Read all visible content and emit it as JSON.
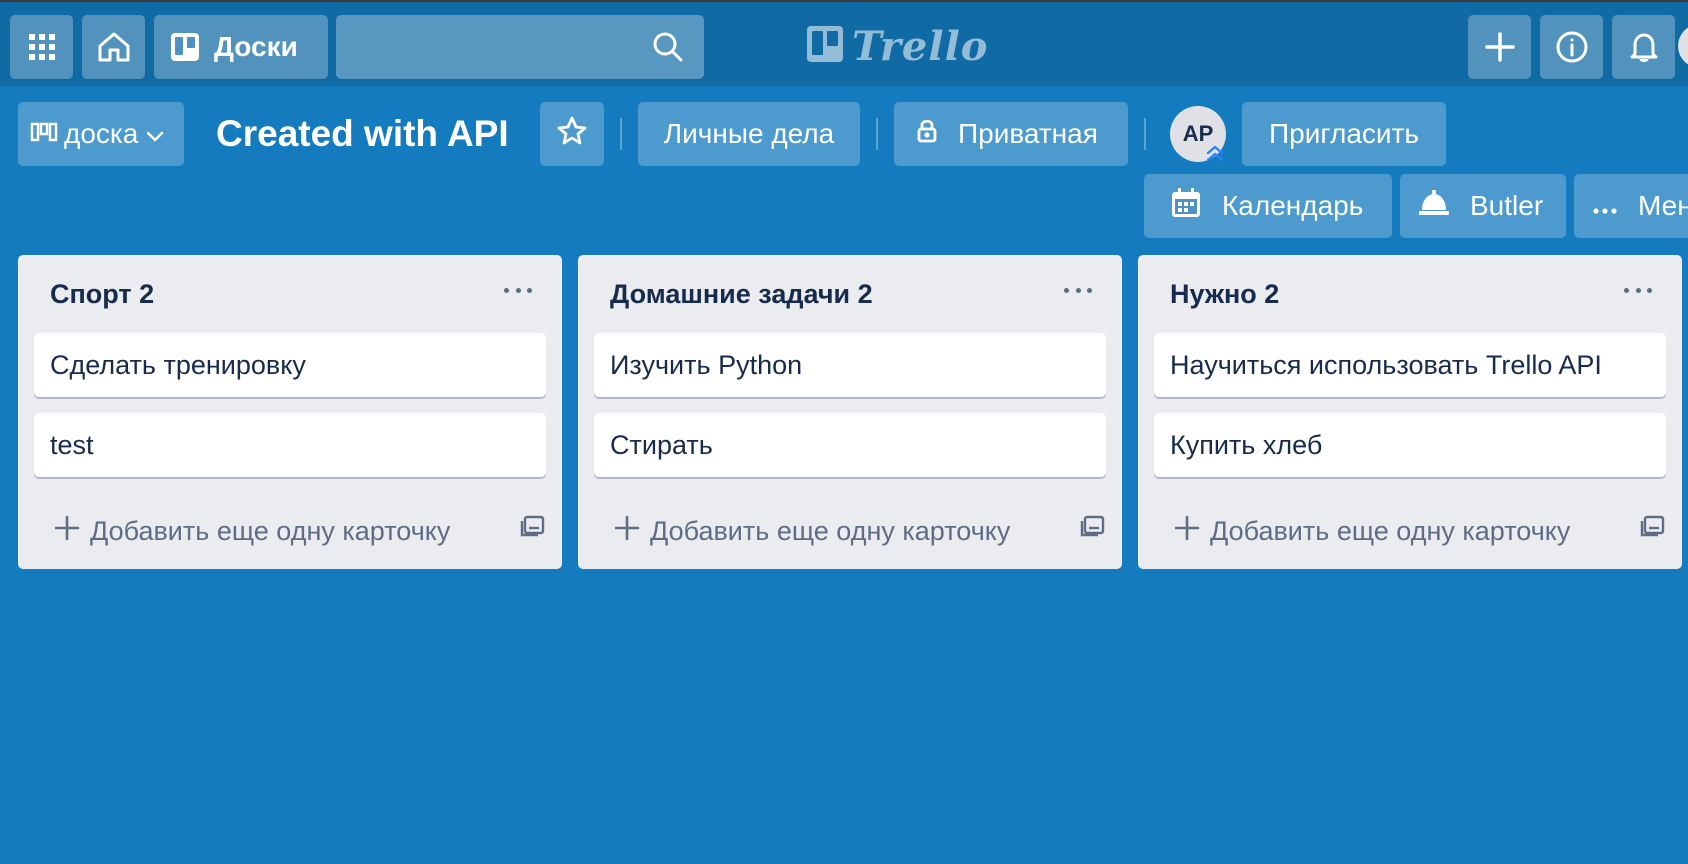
{
  "topbar": {
    "boards_label": "Доски",
    "logo_text": "Trello",
    "search_placeholder": ""
  },
  "board": {
    "switcher_label": "доска",
    "title": "Created with API",
    "team_label": "Личные дела",
    "visibility_label": "Приватная",
    "member_initials": "AP",
    "invite_label": "Пригласить",
    "calendar_label": "Календарь",
    "butler_label": "Butler",
    "menu_label": "Мен"
  },
  "lists": [
    {
      "title": "Спорт 2",
      "cards": [
        "Сделать тренировку",
        "test"
      ],
      "add_label": "Добавить еще одну карточку"
    },
    {
      "title": "Домашние задачи 2",
      "cards": [
        "Изучить Python",
        "Стирать"
      ],
      "add_label": "Добавить еще одну карточку"
    },
    {
      "title": "Нужно 2",
      "cards": [
        "Научиться использовать Trello API",
        "Купить хлеб"
      ],
      "add_label": "Добавить еще одну карточку"
    }
  ],
  "colors": {
    "background": "#147bbf",
    "topbar": "#106aa4",
    "list": "#ebecf0",
    "card": "#ffffff",
    "text": "#172b4d"
  },
  "icons": [
    "apps-icon",
    "home-icon",
    "boards-icon",
    "search-icon",
    "trello-logo-icon",
    "plus-icon",
    "info-icon",
    "bell-icon",
    "board-switcher-icon",
    "chevron-down-icon",
    "star-icon",
    "lock-icon",
    "calendar-icon",
    "butler-icon",
    "ellipsis-icon",
    "template-icon"
  ]
}
